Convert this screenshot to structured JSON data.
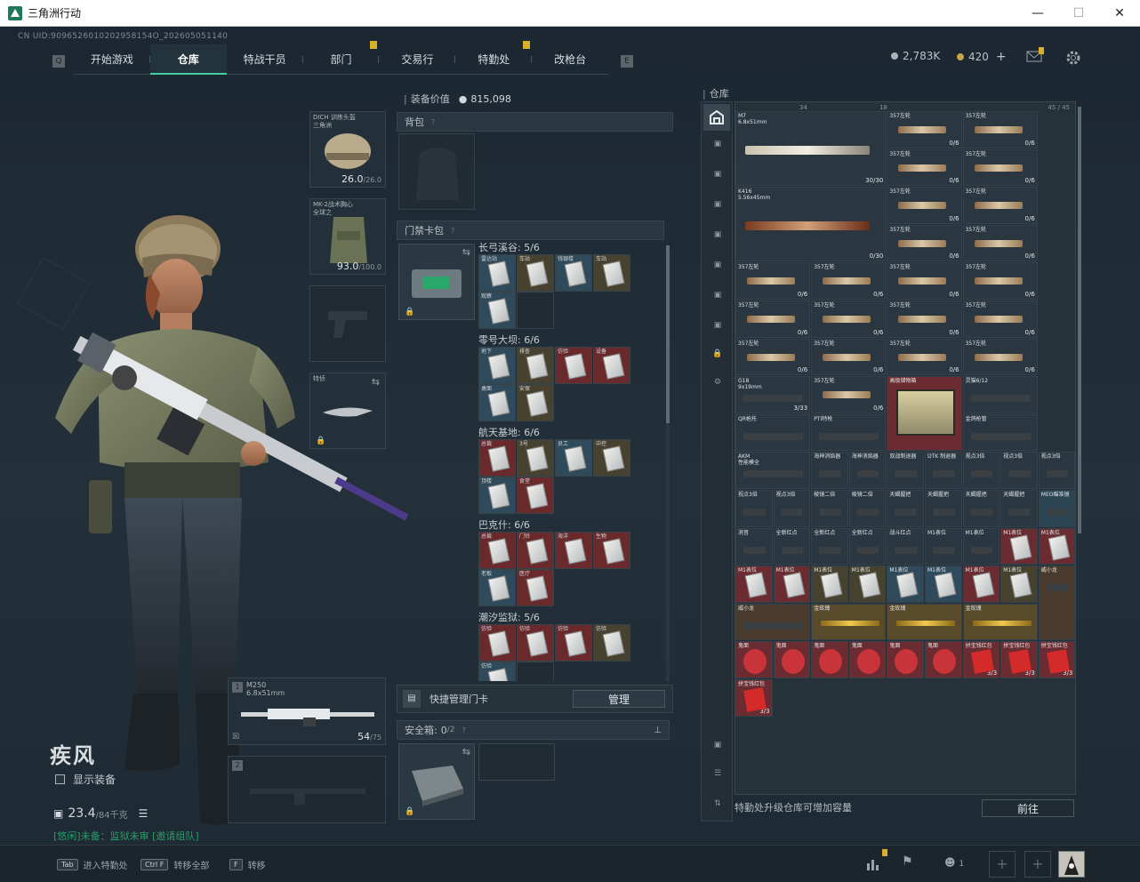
{
  "window": {
    "title": "三角洲行动"
  },
  "uid": "CN UID:9096526010202958154O_202605051140",
  "nav": {
    "tabs": [
      {
        "label": "开始游戏",
        "active": false,
        "badge": false
      },
      {
        "label": "仓库",
        "active": true,
        "badge": false
      },
      {
        "label": "特战干员",
        "active": false,
        "badge": false
      },
      {
        "label": "部门",
        "active": false,
        "badge": true
      },
      {
        "label": "交易行",
        "active": false,
        "badge": false
      },
      {
        "label": "特勤处",
        "active": false,
        "badge": true
      },
      {
        "label": "改枪台",
        "active": false,
        "badge": false
      }
    ]
  },
  "currency": {
    "coins": "2,783K",
    "premium": "420"
  },
  "character": {
    "name": "疾风",
    "show_equipment": "显示装备",
    "weight": "23.4",
    "weight_max": "/84千克",
    "status": "[悠闲]未备：监狱未审 [邀请组队]"
  },
  "equip": {
    "helmet": {
      "label": "DICH 训练头盔\n三角洲",
      "value": "26.0",
      "max": "/26.0"
    },
    "armor": {
      "label": "MK-2战术胸心\n全球之",
      "value": "93.0",
      "max": "/100.0"
    },
    "melee": {
      "label": "特侦"
    },
    "primary": {
      "slot": "1",
      "name": "M250",
      "caliber": "6.8x51mm",
      "ammo": "54",
      "ammo_max": "/75"
    },
    "secondary": {
      "slot": "2"
    }
  },
  "mid": {
    "value_label": "装备价值",
    "value": "815,098",
    "backpack": "背包",
    "keycard": "门禁卡包",
    "groups": [
      {
        "title": "长弓溪谷: 5/6",
        "cards": [
          "雷达站",
          "车站",
          "钱银楼",
          "车站",
          "观察"
        ],
        "empty": 1,
        "red": []
      },
      {
        "title": "零号大坝: 6/6",
        "cards": [
          "地下",
          "排查",
          "仿验",
          "设备",
          "桌面",
          "安保"
        ],
        "empty": 0,
        "red": [
          2,
          3
        ]
      },
      {
        "title": "航天基地: 6/6",
        "cards": [
          "总裁",
          "3号",
          "员工",
          "中控",
          "顶楼",
          "食堂"
        ],
        "empty": 0,
        "red": [
          0,
          5
        ]
      },
      {
        "title": "巴克什: 6/6",
        "cards": [
          "总裁",
          "门铃",
          "海洋",
          "生物",
          "老板",
          "医疗"
        ],
        "empty": 0,
        "red": [
          0,
          1,
          2,
          3,
          5
        ]
      },
      {
        "title": "潮汐监狱: 5/6",
        "cards": [
          "仿验",
          "仿验",
          "仿验",
          "仿验",
          "仿验"
        ],
        "empty": 1,
        "red": [
          0,
          1,
          2
        ]
      }
    ],
    "quick_manage": "快捷管理门卡",
    "manage_btn": "管理",
    "safebox": "安全箱:",
    "safebox_count": "0",
    "safebox_max": "/2"
  },
  "stash": {
    "title": "仓库",
    "footer": "特勤处升级仓库可增加容量",
    "goto_btn": "前往",
    "capacity_a": "34",
    "capacity_b": "18",
    "capacity_c": "45 / 45",
    "rows": [
      {
        "t": "M7",
        "sub": "6.8x51mm",
        "q": "30/30"
      },
      {
        "t": "K416",
        "sub": "5.56x45mm",
        "q": "0/30"
      },
      {
        "t": "357左轮",
        "q": "0/6"
      },
      {
        "t": "G18",
        "sub": "9x19mm",
        "q": "3/33"
      },
      {
        "t": "高级储物箱"
      },
      {
        "t": "灵猫6/12"
      },
      {
        "t": "QR枪托"
      },
      {
        "t": "PTI特枪"
      },
      {
        "t": "金鸽枪管"
      },
      {
        "t": "AKM",
        "sub": "性能模全"
      },
      {
        "t": "海神消焰器"
      },
      {
        "t": "双战制退器"
      },
      {
        "t": "DTK 制退器"
      },
      {
        "t": "视点3倍"
      },
      {
        "t": "棱镜二倍"
      },
      {
        "t": "天蝎握把"
      },
      {
        "t": "MEO瞄准镜"
      },
      {
        "t": "消音"
      },
      {
        "t": "全新红点"
      },
      {
        "t": "战斗红点"
      },
      {
        "t": "M1表位"
      },
      {
        "t": "威小龙"
      },
      {
        "t": "金玫瑰"
      },
      {
        "t": "鬼面"
      },
      {
        "t": "拼宝钱红包",
        "q": "3/3"
      }
    ]
  },
  "bottom": {
    "hint1_key": "Tab",
    "hint1": "进入特勤处",
    "hint2_key": "Ctrl F",
    "hint2": "转移全部",
    "hint3_key": "F",
    "hint3": "转移",
    "friends": "1"
  }
}
